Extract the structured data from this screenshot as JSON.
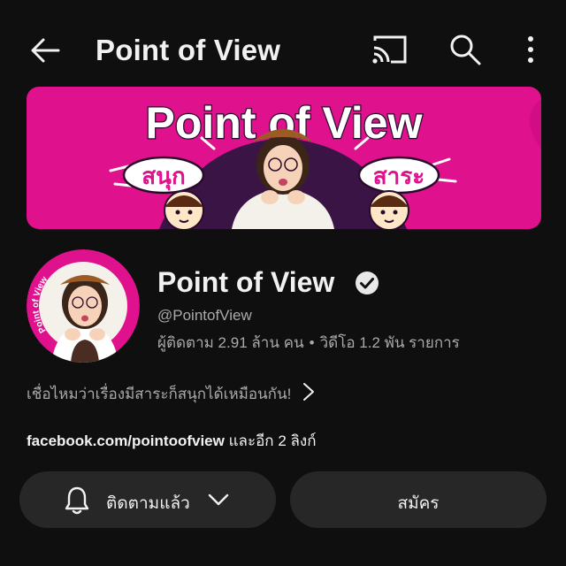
{
  "header": {
    "title": "Point of View"
  },
  "banner": {
    "headline": "Point of View",
    "left_badge": "สนุก",
    "right_badge": "สาระ"
  },
  "avatar": {
    "ring_text": "Point of View"
  },
  "channel": {
    "name": "Point of View",
    "handle": "@PointofView",
    "subscribers": "ผู้ติดตาม 2.91 ล้าน คน",
    "separator": "•",
    "videos": "วิดีโอ 1.2 พัน รายการ",
    "description": "เชื่อไหมว่าเรื่องมีสาระก็สนุกได้เหมือนกัน!",
    "link_main": "facebook.com/pointoofview",
    "link_more": "และอีก 2 ลิงก์"
  },
  "actions": {
    "subscribed_label": "ติดตามแล้ว",
    "join_label": "สมัคร"
  },
  "colors": {
    "background": "#0f0f0f",
    "button_bg": "#272727",
    "banner_pink": "#e0118c",
    "banner_purple": "#3a1445",
    "secondary_text": "#aaaaaa"
  }
}
